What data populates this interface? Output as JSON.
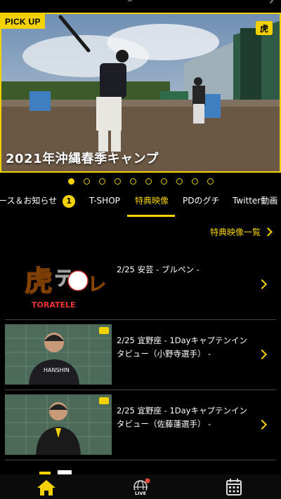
{
  "hero": {
    "badge": "PICK UP",
    "title": "2021年沖縄春季キャンプ",
    "logo_icon": "toratele-logo-small"
  },
  "carousel": {
    "count": 10,
    "active_index": 0
  },
  "tabs": [
    {
      "label": "ース＆お知らせ",
      "badge": "1"
    },
    {
      "label": "T-SHOP"
    },
    {
      "label": "特典映像",
      "active": true
    },
    {
      "label": "PDのグチ"
    },
    {
      "label": "Twitter動画"
    }
  ],
  "section": {
    "more_link": "特典映像一覧"
  },
  "videos": [
    {
      "title": "2/25 安芸 - ブルペン -",
      "thumb": "toratele-logo"
    },
    {
      "title": "2/25 宜野座 - 1Dayキャプテンインタビュー（小野寺選手） -",
      "thumb": "player-photo"
    },
    {
      "title": "2/25 宜野座 - 1Dayキャプテンインタビュー（佐藤蓮選手） -",
      "thumb": "player-photo"
    }
  ],
  "logo_text": "TORATELE",
  "nav": [
    {
      "icon": "home-icon",
      "active": true
    },
    {
      "icon": "live-globe-icon",
      "label": "LIVE",
      "notification": true
    },
    {
      "icon": "calendar-icon"
    }
  ],
  "colors": {
    "accent": "#f4d100",
    "background": "#000000"
  }
}
